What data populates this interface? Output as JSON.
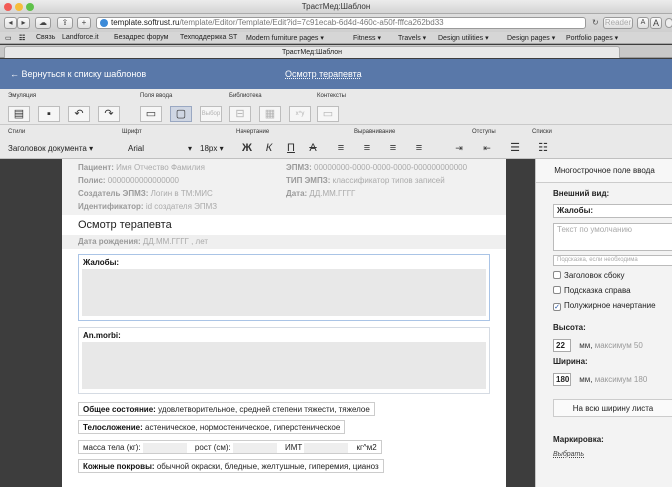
{
  "window": {
    "title": "ТрастМед:Шаблон"
  },
  "browser": {
    "url_host": "template.softrust.ru",
    "url_path": "/template/Editor/Template/Edit?id=7c91ecab-6d4d-460c-a50f-fffca262bd33",
    "reader_label": "Reader",
    "font_small": "A",
    "font_large": "A",
    "reload_icon": "reload-icon"
  },
  "bookmarks": [
    "Связь",
    "Landforce.it",
    "Безадрес форум",
    "Техподдержка ST",
    "Modern furniture pages ▾",
    "Fitness ▾",
    "Travels ▾",
    "Design utilities ▾",
    "Design pages ▾",
    "Portfolio pages ▾"
  ],
  "tab_title": "ТрастМед:Шаблон",
  "header": {
    "back_link": "← Вернуться к списку шаблонов",
    "template_name": "Осмотр терапевта"
  },
  "toolbar1": {
    "groups": [
      "Эмуляция",
      "Поля ввода",
      "Библиотека",
      "Контексты"
    ],
    "select_label": "Выбор"
  },
  "toolbar2": {
    "groups": [
      "Стили",
      "Шрифт",
      "Начертание",
      "Выравнивание",
      "Отступы",
      "Списки"
    ],
    "style": "Заголовок документа",
    "font": "Arial",
    "size": "18px",
    "bold": "Ж",
    "italic": "К",
    "underline": "П",
    "strike": "А"
  },
  "doc": {
    "meta": [
      {
        "label": "Пациент:",
        "value": "Имя Отчество Фамилия"
      },
      {
        "label": "ЭПМЗ:",
        "value": "00000000-0000-0000-0000-000000000000"
      },
      {
        "label": "Полис:",
        "value": "0000000000000000"
      },
      {
        "label": "ТИП ЭМПЗ:",
        "value": "классификатор типов записей"
      },
      {
        "label": "Создатель ЭПМЗ:",
        "value": "Логин в ТМ:МИС"
      },
      {
        "label": "Дата:",
        "value": "ДД.ММ.ГГГГ"
      },
      {
        "label": "Идентификатор:",
        "value": "id создателя ЭПМЗ"
      }
    ],
    "heading": "Осмотр терапевта",
    "birth_label": "Дата рождения:",
    "birth_value": "ДД.ММ.ГГГГ , лет",
    "complaints_label": "Жалобы:",
    "anmorbi_label": "An.morbi:",
    "general_label": "Общее состояние:",
    "general_value": "удовлетворительное, средней степени тяжести, тяжелое",
    "build_label": "Телосложение:",
    "build_value": "астеническое, нормостеническое, гиперстеническое",
    "mass_label": "масса тела (кг):",
    "height_label": "рост (см):",
    "bmi_label": "ИМТ",
    "bmi_unit": "кг^м2",
    "skin_label": "Кожные покровы:",
    "skin_value": "обычной окраски, бледные, желтушные, гиперемия, цианоз"
  },
  "panel": {
    "title": "Многострочное поле ввода",
    "appearance": "Внешний вид:",
    "field_name": "Жалобы:",
    "default_placeholder": "Текст по умолчанию",
    "hint_placeholder": "Подсказка, если необходима",
    "cb_side_title": "Заголовок сбоку",
    "cb_hint_right": "Подсказка справа",
    "cb_bold": "Полужирное начертание",
    "height_label": "Высота:",
    "height_value": "22",
    "height_unit": "мм,",
    "height_max": "максимум 50",
    "width_label": "Ширина:",
    "width_value": "180",
    "width_unit": "мм,",
    "width_max": "максимум 180",
    "full_width": "На всю ширину листа",
    "marking_label": "Маркировка:",
    "marking_link": "Выбрать"
  }
}
